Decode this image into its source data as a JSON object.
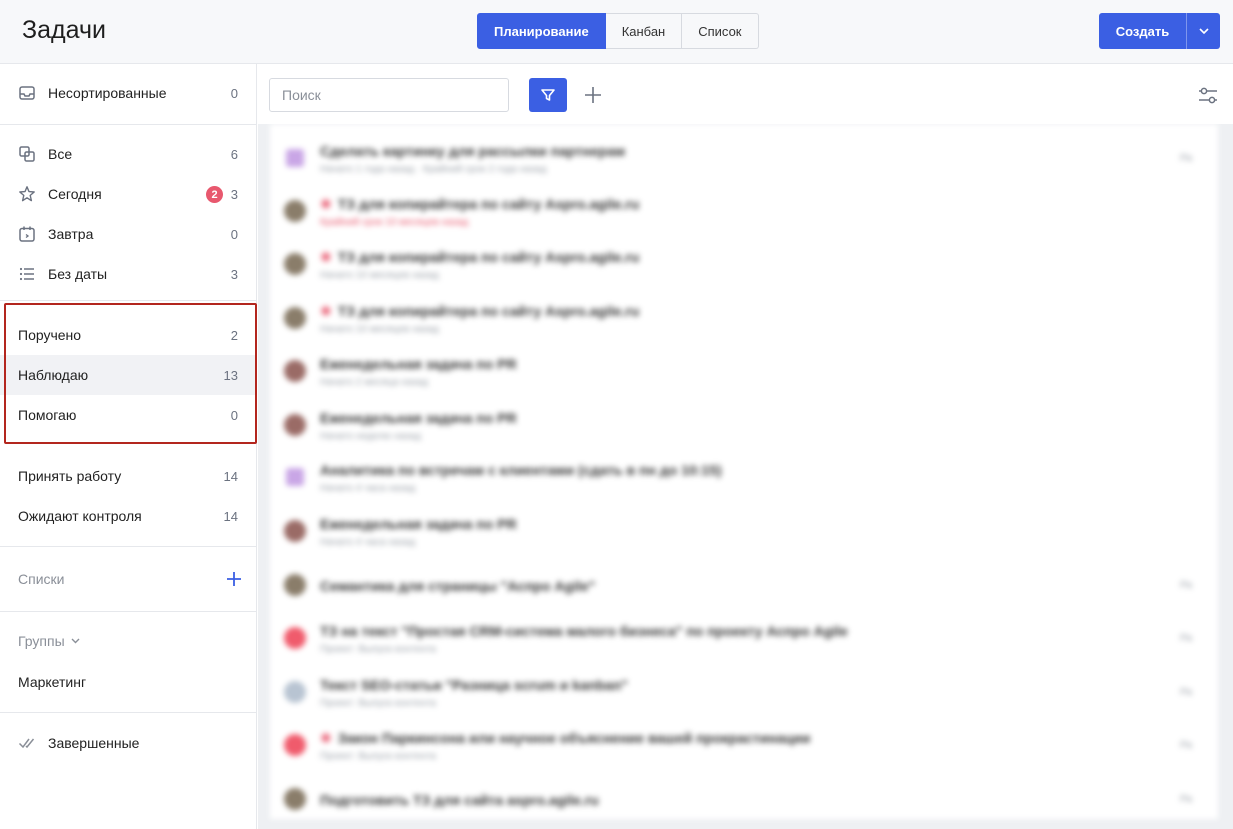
{
  "header": {
    "title": "Задачи",
    "views": [
      {
        "label": "Планирование",
        "active": true
      },
      {
        "label": "Канбан",
        "active": false
      },
      {
        "label": "Список",
        "active": false
      }
    ],
    "create_label": "Создать"
  },
  "sidebar": {
    "unsorted": {
      "label": "Несортированные",
      "count": "0"
    },
    "all": {
      "label": "Все",
      "count": "6"
    },
    "today": {
      "label": "Сегодня",
      "badge": "2",
      "count": "3"
    },
    "tomorrow": {
      "label": "Завтра",
      "count": "0"
    },
    "no_date": {
      "label": "Без даты",
      "count": "3"
    },
    "assigned": {
      "label": "Поручено",
      "count": "2"
    },
    "watching": {
      "label": "Наблюдаю",
      "count": "13"
    },
    "helping": {
      "label": "Помогаю",
      "count": "0"
    },
    "accept_work": {
      "label": "Принять работу",
      "count": "14"
    },
    "await_control": {
      "label": "Ожидают контроля",
      "count": "14"
    },
    "lists_label": "Списки",
    "groups_label": "Группы",
    "group_marketing": "Маркетинг",
    "completed": "Завершенные"
  },
  "toolbar": {
    "search_placeholder": "Поиск"
  },
  "colors": {
    "accent": "#3b5fe3",
    "badge": "#e8586e",
    "highlight_border": "#b3261e"
  },
  "tasks": [
    {
      "title": "Сделать картинку для рассылки партнерам",
      "meta": "Начато 1 года назад  ·  Крайний срок 2 года назад",
      "urgent": false,
      "avatar": "#c9a6e6",
      "square": true,
      "right": "Ра"
    },
    {
      "title": "ТЗ для копирайтера по сайту Aspro.agile.ru",
      "meta": "Крайний срок 10 месяцев назад",
      "meta_red": true,
      "urgent": true,
      "avatar": "#8a7d6a",
      "square": false,
      "right": ""
    },
    {
      "title": "ТЗ для копирайтера по сайту Aspro.agile.ru",
      "meta": "Начато 10 месяцев назад",
      "urgent": true,
      "avatar": "#8a7d6a",
      "square": false,
      "right": ""
    },
    {
      "title": "ТЗ для копирайтера по сайту Aspro.agile.ru",
      "meta": "Начато 10 месяцев назад",
      "urgent": true,
      "avatar": "#8a7d6a",
      "square": false,
      "right": ""
    },
    {
      "title": "Еженедельная задача по PR",
      "meta": "Начато 2 месяца назад",
      "urgent": false,
      "avatar": "#9a6b66",
      "square": false,
      "right": ""
    },
    {
      "title": "Еженедельная задача по PR",
      "meta": "Начато неделю назад",
      "urgent": false,
      "avatar": "#9a6b66",
      "square": false,
      "right": ""
    },
    {
      "title": "Аналитика по встречам с клиентами (сдать в пн до 10:15)",
      "meta": "Начато 4 часа назад",
      "urgent": false,
      "avatar": "#c9a6e6",
      "square": true,
      "right": ""
    },
    {
      "title": "Еженедельная задача по PR",
      "meta": "Начато 4 часа назад",
      "urgent": false,
      "avatar": "#9a6b66",
      "square": false,
      "right": ""
    },
    {
      "title": "Семантика для страницы \"Аспро Agile\"",
      "meta": "",
      "urgent": false,
      "avatar": "#8a7d6a",
      "square": false,
      "right": "Ра"
    },
    {
      "title": "ТЗ на текст \"Простая CRM-система малого бизнеса\" по проекту Аспро Agile",
      "meta": "Проект: Выпуск контента",
      "urgent": false,
      "avatar": "#f05b6c",
      "square": false,
      "right": "Ра"
    },
    {
      "title": "Текст SEO-статьи \"Разница scrum и kanban\"",
      "meta": "Проект: Выпуск контента",
      "urgent": false,
      "avatar": "#b8c4d2",
      "square": false,
      "right": "Ра"
    },
    {
      "title": "Закон Паркинсона или научное объяснение вашей прокрастинации",
      "meta": "Проект: Выпуск контента",
      "urgent": true,
      "avatar": "#f05b6c",
      "square": false,
      "right": "Ра"
    },
    {
      "title": "Подготовить ТЗ для сайта aspro.agile.ru",
      "meta": "",
      "urgent": false,
      "avatar": "#8a7d6a",
      "square": false,
      "right": "Ра"
    }
  ]
}
